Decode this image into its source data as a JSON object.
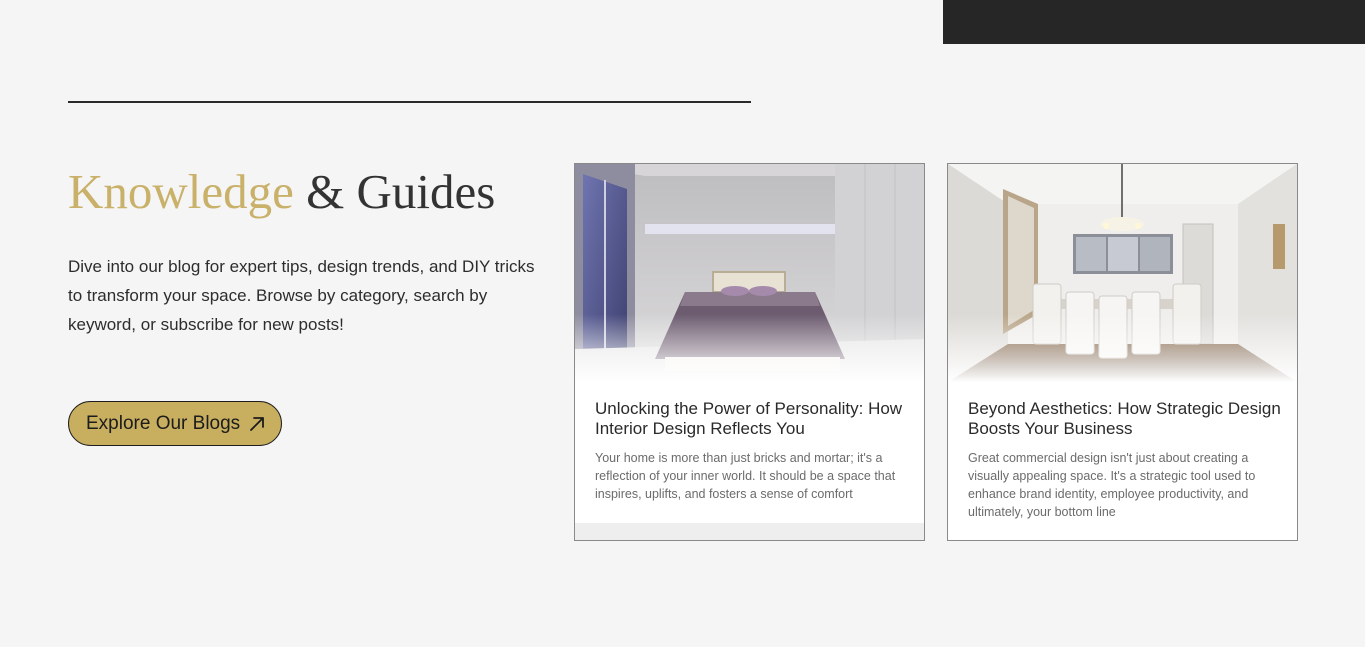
{
  "hero": {
    "heading_accent": "Knowledge",
    "heading_rest": " & Guides",
    "intro": "Dive into our blog for expert tips, design trends, and DIY tricks to transform your space. Browse by category, search by keyword, or subscribe for new posts!",
    "cta_label": "Explore Our Blogs",
    "cta_icon": "arrow-up-right-icon"
  },
  "posts": [
    {
      "title": "Unlocking the Power of Personality: How Interior Design Reflects You",
      "excerpt": "Your home is more than just bricks and mortar; it's a reflection of your inner world. It should be a space that inspires, uplifts, and fosters a sense of comfort",
      "image": "bedroom-photo"
    },
    {
      "title": "Beyond Aesthetics: How Strategic Design Boosts Your Business",
      "excerpt": "Great commercial design isn't just about creating a visually appealing space. It's a strategic tool used to enhance brand identity, employee productivity, and ultimately, your bottom line",
      "image": "dining-room-photo"
    }
  ],
  "colors": {
    "accent_gold": "#c9b16a",
    "button_gold": "#c8ae5f",
    "dark_bar": "#262626",
    "page_bg": "#f5f5f5"
  }
}
